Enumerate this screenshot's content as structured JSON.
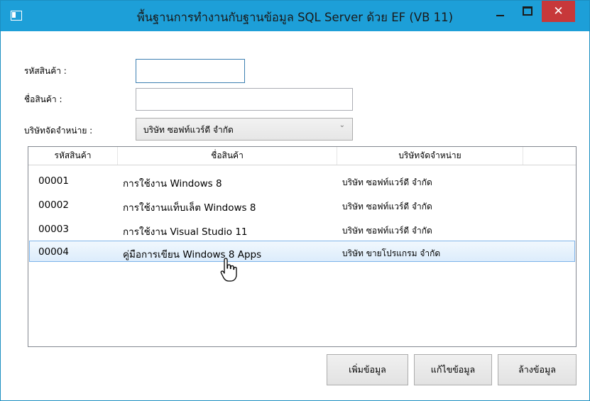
{
  "window": {
    "title": "พื้นฐานการทำงานกับฐานข้อมูล SQL Server ด้วย EF (VB 11)",
    "close_glyph": "✕"
  },
  "form": {
    "product_id_label": "รหัสสินค้า :",
    "product_id_value": "",
    "product_name_label": "ชื่อสินค้า :",
    "product_name_value": "",
    "distributor_label": "บริษัทจัดจำหน่าย :",
    "distributor_selected": "บริษัท ซอฟท์แวร์ดี จำกัด",
    "dropdown_glyph": "⌄"
  },
  "table": {
    "headers": [
      "รหัสสินค้า",
      "ชื่อสินค้า",
      "บริษัทจัดจำหน่าย"
    ],
    "rows": [
      [
        "00001",
        "การใช้งาน Windows 8",
        "บริษัท ซอฟท์แวร์ดี จำกัด"
      ],
      [
        "00002",
        "การใช้งานแท็บเล็ต Windows 8",
        "บริษัท ซอฟท์แวร์ดี จำกัด"
      ],
      [
        "00003",
        "การใช้งาน Visual Studio 11",
        "บริษัท ซอฟท์แวร์ดี จำกัด"
      ],
      [
        "00004",
        "คู่มือการเขียน Windows 8 Apps",
        "บริษัท ขายโปรแกรม จำกัด"
      ]
    ],
    "selected_row_index": 3
  },
  "buttons": {
    "add": "เพิ่มข้อมูล",
    "edit": "แก้ไขข้อมูล",
    "clear": "ล้างข้อมูล"
  },
  "colors": {
    "titlebar": "#1d9fd8",
    "close_button": "#c7383a",
    "selection": "#dcecfc"
  },
  "cursor": "hand-pointer"
}
